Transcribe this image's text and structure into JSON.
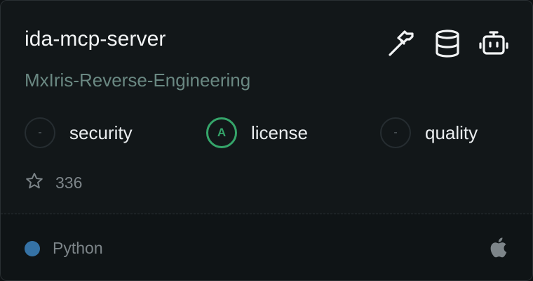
{
  "repo": {
    "name": "ida-mcp-server",
    "owner": "MxIris-Reverse-Engineering"
  },
  "top_icons": [
    "hammer-icon",
    "database-icon",
    "robot-icon"
  ],
  "metrics": [
    {
      "grade": "-",
      "label": "security",
      "status": "none"
    },
    {
      "grade": "A",
      "label": "license",
      "status": "good"
    },
    {
      "grade": "-",
      "label": "quality",
      "status": "none"
    }
  ],
  "stars": {
    "icon": "star-icon",
    "count": "336"
  },
  "footer": {
    "language": "Python",
    "language_color": "#3572A5",
    "platform_icon": "apple-icon"
  },
  "colors": {
    "good": "#35a56a",
    "muted": "#7d8589"
  }
}
